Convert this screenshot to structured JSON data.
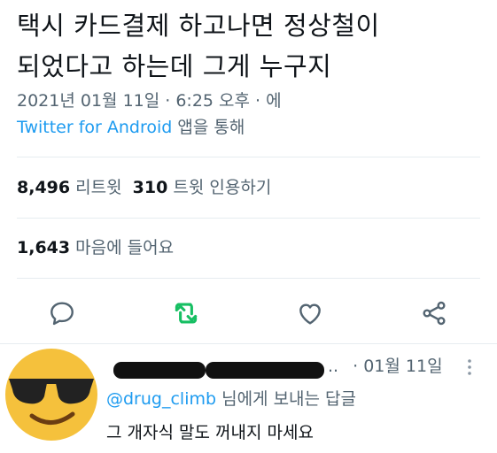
{
  "tweet": {
    "line1": "택시 카드결제 하고나면 정상철이",
    "line2": "되었다고 하는데 그게 누구지",
    "timestamp": "2021년 01월 11일 · 6:25 오후 · 에",
    "source_link": "Twitter for Android",
    "source_suffix": " 앱을 통해"
  },
  "stats": {
    "retweets_count": "8,496",
    "retweets_label": " 리트윗  ",
    "quotes_count": "310",
    "quotes_label": " 트윗 인용하기",
    "likes_count": "1,643",
    "likes_label": " 마음에 들어요"
  },
  "actions": {
    "reply_icon": "speech-bubble-icon",
    "retweet_icon": "retweet-icon",
    "like_icon": "heart-icon",
    "share_icon": "share-icon",
    "retweet_color": "#17bf63",
    "icon_color": "#536471"
  },
  "reply": {
    "ellipsis": "..",
    "date": "· 01월 11일",
    "replying_handle": "@drug_climb",
    "replying_suffix": " 님에게 보내는 답글",
    "text": "그 개자식 말도 꺼내지 마세요",
    "avatar_icon": "sunglasses-emoji-avatar"
  }
}
